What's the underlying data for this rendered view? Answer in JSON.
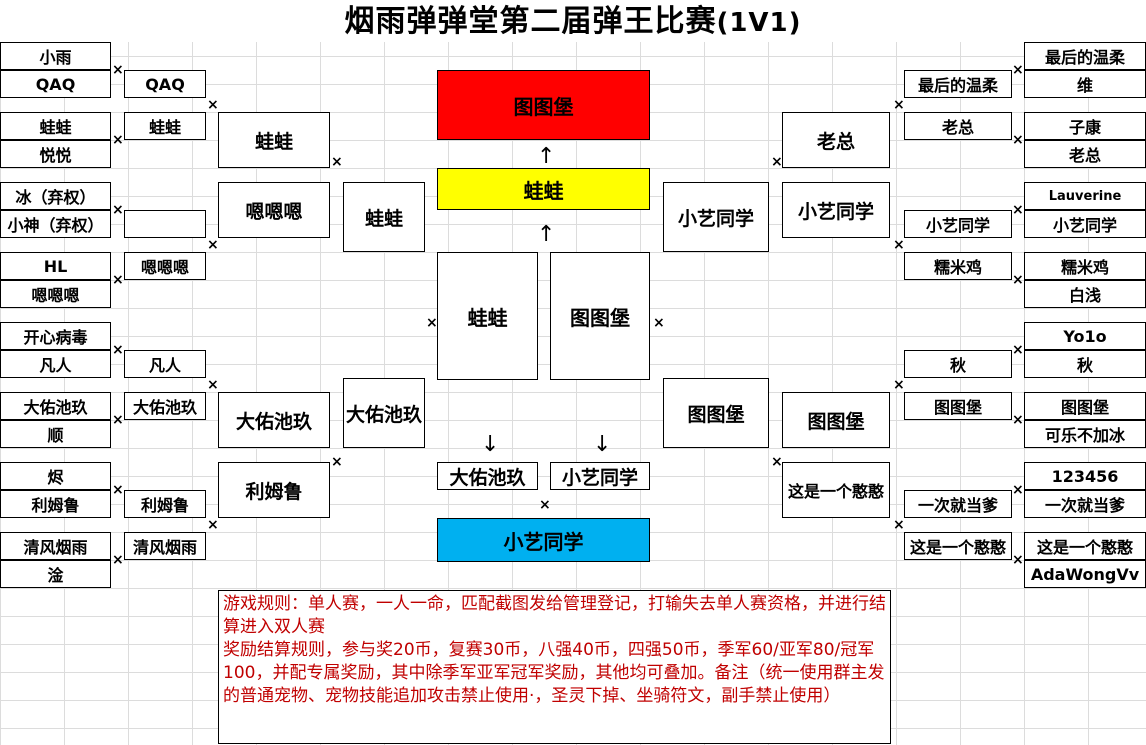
{
  "title": {
    "main": "烟雨弹弹堂第二届弹王比赛",
    "suffix": "(1V1)"
  },
  "left_r1": [
    "小雨",
    "QAQ",
    "蛙蛙",
    "悦悦",
    "冰（弃权）",
    "小神（弃权）",
    "HL",
    "嗯嗯嗯",
    "开心病毒",
    "凡人",
    "大佑池玖",
    "顺",
    "烬",
    "利姆鲁",
    "清风烟雨",
    "淦"
  ],
  "left_r2": [
    "QAQ",
    "蛙蛙",
    "",
    "嗯嗯嗯",
    "凡人",
    "大佑池玖",
    "利姆鲁",
    "清风烟雨"
  ],
  "left_r3": [
    "蛙蛙",
    "嗯嗯嗯",
    "大佑池玖",
    "利姆鲁"
  ],
  "left_r4": [
    "蛙蛙",
    "大佑池玖"
  ],
  "right_r1": [
    "最后的温柔",
    "维",
    "子康",
    "老总",
    "Lauverine",
    "小艺同学",
    "糯米鸡",
    "白浅",
    "Yo1o",
    "秋",
    "图图堡",
    "可乐不加冰",
    "123456",
    "一次就当爹",
    "这是一个憨憨",
    "AdaWongVv"
  ],
  "right_r2": [
    "最后的温柔",
    "老总",
    "小艺同学",
    "糯米鸡",
    "秋",
    "图图堡",
    "一次就当爹",
    "这是一个憨憨"
  ],
  "right_r3": [
    "老总",
    "小艺同学",
    "图图堡",
    "这是一个憨憨"
  ],
  "right_r4": [
    "小艺同学",
    "图图堡"
  ],
  "center": {
    "champion": "图图堡",
    "runner_up": "蛙蛙",
    "semi_left": "蛙蛙",
    "semi_right": "图图堡",
    "loser_left": "大佑池玖",
    "loser_right": "小艺同学",
    "third": "小艺同学",
    "arrow_up": "↑",
    "arrow_down": "↓"
  },
  "colors": {
    "champion": "#ff0000",
    "runner_up": "#ffff00",
    "third": "#00b0f0",
    "rules_text": "#c00000"
  },
  "vs_mark": "×",
  "rules": [
    "游戏规则：单人赛，一人一命，匹配截图发给管理登记，打输失去单人赛资格，并进行结算进入双人赛",
    "奖励结算规则，参与奖20币，复赛30币，八强40币，四强50币，季军60/亚军80/冠军100，并配专属奖励，其中除季军亚军冠军奖励，其他均可叠加。备注（统一使用群主发的普通宠物、宠物技能追加攻击禁止使用·，圣灵下掉、坐骑符文，副手禁止使用）"
  ]
}
